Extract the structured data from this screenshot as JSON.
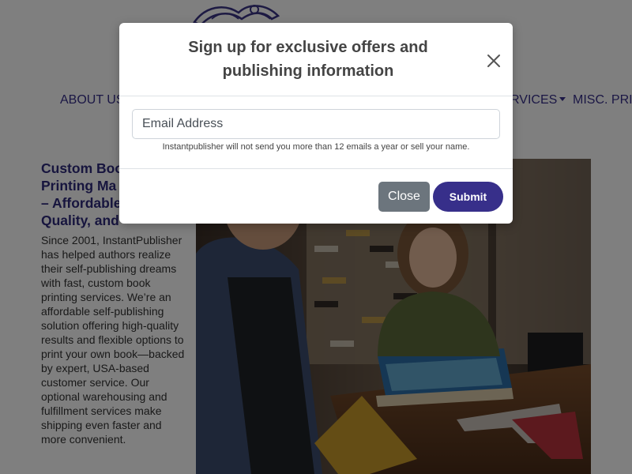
{
  "nav": {
    "items": [
      {
        "label": "ABOUT US"
      },
      {
        "label": "RVICES"
      },
      {
        "label": "MISC. PRIN"
      }
    ]
  },
  "hero": {
    "title": "Custom Book Printing Ma... – Affordable Quality, and...",
    "title_lines": [
      "Custom Boo",
      "Printing Ma",
      "– Affordable",
      "Quality, and"
    ],
    "body": "Since 2001, InstantPublisher has helped authors realize their self-publishing dreams with fast, custom book printing services. We’re an affordable self-publishing solution offering high-quality results and flexible options to print your own book—backed by expert, USA-based customer service. Our optional warehousing and fulfillment services make shipping even faster and more convenient."
  },
  "modal": {
    "title": "Sign up for exclusive offers and publishing information",
    "email_placeholder": "Email Address",
    "email_value": "",
    "helper": "Instantpublisher will not send you more than 12 emails a year or sell your name.",
    "close_label": "Close",
    "submit_label": "Submit",
    "close_icon": "close-icon"
  },
  "colors": {
    "brand": "#372f8a",
    "heading": "#2e2a7c",
    "close_button": "#6c757d",
    "backdrop": "rgba(0,0,0,0.5)"
  }
}
